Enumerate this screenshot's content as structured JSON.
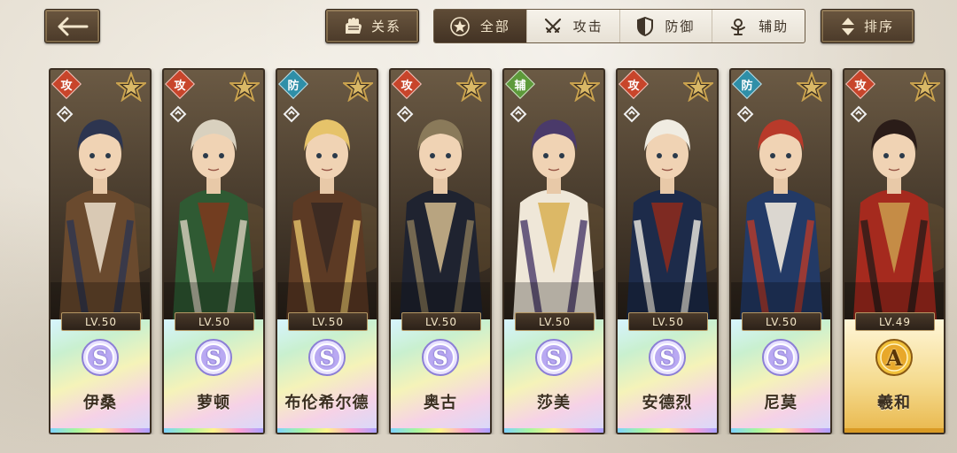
{
  "toolbar": {
    "back_icon": "arrow-left-icon",
    "relation_label": "关系",
    "relation_icon": "glove-icon",
    "sort_label": "排序",
    "sort_icon": "sort-arrows-icon"
  },
  "filters": [
    {
      "label": "全部",
      "icon": "star-circle-icon",
      "active": true
    },
    {
      "label": "攻击",
      "icon": "crossed-swords-icon",
      "active": false
    },
    {
      "label": "防御",
      "icon": "shield-icon",
      "active": false
    },
    {
      "label": "辅助",
      "icon": "support-icon",
      "active": false
    }
  ],
  "colors": {
    "accent_dark": "#4b3a29",
    "attack": "#c8452b",
    "defense": "#2f8fa8",
    "support": "#5d9a3a",
    "gold": "#d89a24"
  },
  "characters": [
    {
      "name": "伊桑",
      "role": "攻",
      "level": "LV.50",
      "rank": "S",
      "palette": [
        "#6a4a2e",
        "#2d3550",
        "#e6d7c3"
      ]
    },
    {
      "name": "萝顿",
      "role": "攻",
      "level": "LV.50",
      "rank": "S",
      "palette": [
        "#2f5a33",
        "#d9d1bf",
        "#7a3a1e"
      ]
    },
    {
      "name": "布伦希尔德",
      "role": "防",
      "level": "LV.50",
      "rank": "S",
      "palette": [
        "#5c3a24",
        "#e6c36a",
        "#3a2a22"
      ]
    },
    {
      "name": "奥古",
      "role": "攻",
      "level": "LV.50",
      "rank": "S",
      "palette": [
        "#1f2330",
        "#8a7a5a",
        "#c9b38a"
      ]
    },
    {
      "name": "莎美",
      "role": "辅",
      "level": "LV.50",
      "rank": "S",
      "palette": [
        "#efe7d8",
        "#4a3a6a",
        "#d9b25a"
      ]
    },
    {
      "name": "安德烈",
      "role": "攻",
      "level": "LV.50",
      "rank": "S",
      "palette": [
        "#1d2b4a",
        "#f0ece2",
        "#8a2a1e"
      ]
    },
    {
      "name": "尼莫",
      "role": "防",
      "level": "LV.50",
      "rank": "S",
      "palette": [
        "#233a66",
        "#b83a2a",
        "#efe9dc"
      ]
    },
    {
      "name": "羲和",
      "role": "攻",
      "level": "LV.49",
      "rank": "A",
      "palette": [
        "#a52a1e",
        "#2a1c18",
        "#c9974a"
      ]
    }
  ]
}
